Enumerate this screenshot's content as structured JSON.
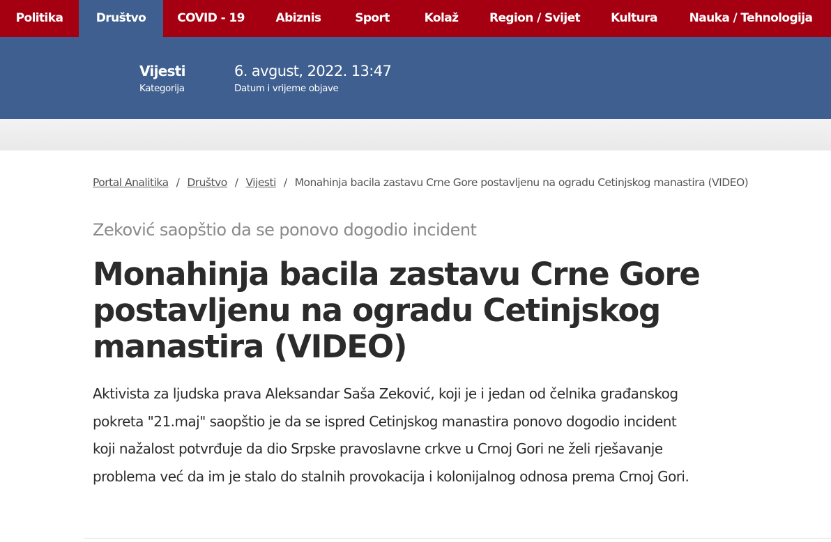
{
  "nav": {
    "items": [
      {
        "label": "Politika"
      },
      {
        "label": "Društvo"
      },
      {
        "label": "COVID - 19"
      },
      {
        "label": "Abiznis"
      },
      {
        "label": "Sport"
      },
      {
        "label": "Kolaž"
      },
      {
        "label": "Region / Svijet"
      },
      {
        "label": "Kultura"
      },
      {
        "label": "Nauka / Tehnologija"
      }
    ],
    "active_index": 1
  },
  "info": {
    "category_value": "Vijesti",
    "category_label": "Kategorija",
    "date_value": "6. avgust, 2022. 13:47",
    "date_label": "Datum i vrijeme objave"
  },
  "breadcrumb": {
    "items": [
      "Portal Analitika",
      "Društvo",
      "Vijesti"
    ],
    "separator": "/",
    "current": "Monahinja bacila zastavu Crne Gore postavljenu na ogradu Cetinjskog manastira (VIDEO)"
  },
  "article": {
    "subtitle": "Zeković saopštio da se ponovo dogodio incident",
    "title": "Monahinja bacila zastavu Crne Gore postavljenu na ogradu Cetinjskog manastira (VIDEO)",
    "lead": "Aktivista za ljudska prava Aleksandar Saša Zeković, koji je i jedan od čelnika građanskog pokreta \"21.maj\" saopštio je da se ispred Cetinjskog manastira ponovo dogodio incident koji nažalost potvrđuje da dio Srpske pravoslavne crkve u Crnoj Gori ne želi rješavanje problema već da im je stalo do stalnih provokacija i kolonijalnog odnosa prema Crnoj Gori."
  },
  "colors": {
    "nav_bg": "#a50011",
    "accent_blue": "#3e5f8f",
    "text": "#2b2b2b",
    "muted": "#8a8a8a"
  }
}
